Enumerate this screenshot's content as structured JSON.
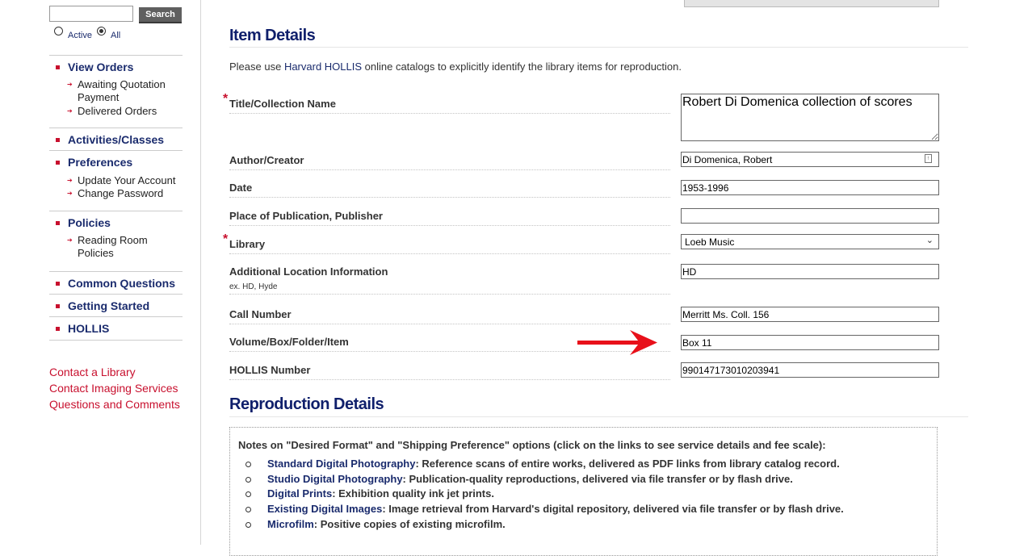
{
  "sidebar": {
    "search": {
      "value": "",
      "button_label": "Search"
    },
    "filter": {
      "active_label": "Active",
      "all_label": "All",
      "selected": "All"
    },
    "nav": {
      "view_orders": "View Orders",
      "awaiting_quotation": "Awaiting Quotation Payment",
      "delivered_orders": "Delivered Orders",
      "activities": "Activities/Classes",
      "preferences": "Preferences",
      "update_account": "Update Your Account",
      "change_password": "Change Password",
      "policies": "Policies",
      "reading_room": "Reading Room Policies",
      "common_questions": "Common Questions",
      "getting_started": "Getting Started",
      "hollis": "HOLLIS"
    },
    "contacts": {
      "library": "Contact a Library",
      "imaging": "Contact Imaging Services",
      "questions": "Questions and Comments"
    }
  },
  "item_details": {
    "heading": "Item Details",
    "intro_prefix": "Please use ",
    "intro_link": "Harvard HOLLIS",
    "intro_suffix": " online catalogs to explicitly identify the library items for reproduction.",
    "fields": {
      "title": {
        "label": "Title/Collection Name",
        "value": "Robert Di Domenica collection of scores"
      },
      "author": {
        "label": "Author/Creator",
        "value": "Di Domenica, Robert"
      },
      "date": {
        "label": "Date",
        "value": "1953-1996"
      },
      "place": {
        "label": "Place of Publication, Publisher",
        "value": ""
      },
      "library": {
        "label": "Library",
        "value": "Loeb Music"
      },
      "location": {
        "label": "Additional Location Information",
        "hint": "ex. HD, Hyde",
        "value": "HD"
      },
      "call_number": {
        "label": "Call Number",
        "value": "Merritt Ms. Coll. 156"
      },
      "volume": {
        "label": "Volume/Box/Folder/Item",
        "value": "Box 11"
      },
      "hollis_number": {
        "label": "HOLLIS Number",
        "value": "990147173010203941"
      }
    },
    "required_marker": "*"
  },
  "reproduction": {
    "heading": "Reproduction Details",
    "notes_heading": "Notes on \"Desired Format\" and \"Shipping Preference\" options (click on the links to see service details and fee scale):",
    "items": [
      {
        "link": "Standard Digital Photography",
        "text": ": Reference scans of entire works, delivered as PDF links from library catalog record."
      },
      {
        "link": "Studio Digital Photography",
        "text": ": Publication-quality reproductions, delivered via file transfer or by flash drive."
      },
      {
        "link": "Digital Prints",
        "text": ": Exhibition quality ink jet prints."
      },
      {
        "link": "Existing Digital Images",
        "text": ": Image retrieval from Harvard's digital repository, delivered via file transfer or by flash drive."
      },
      {
        "link": "Microfilm",
        "text": ": Positive copies of existing microfilm."
      }
    ]
  },
  "colors": {
    "nav_blue": "#1a2b6d",
    "heading_blue": "#0f1f6b",
    "accent_red": "#c8102e",
    "arrow_red": "#e8101a"
  }
}
